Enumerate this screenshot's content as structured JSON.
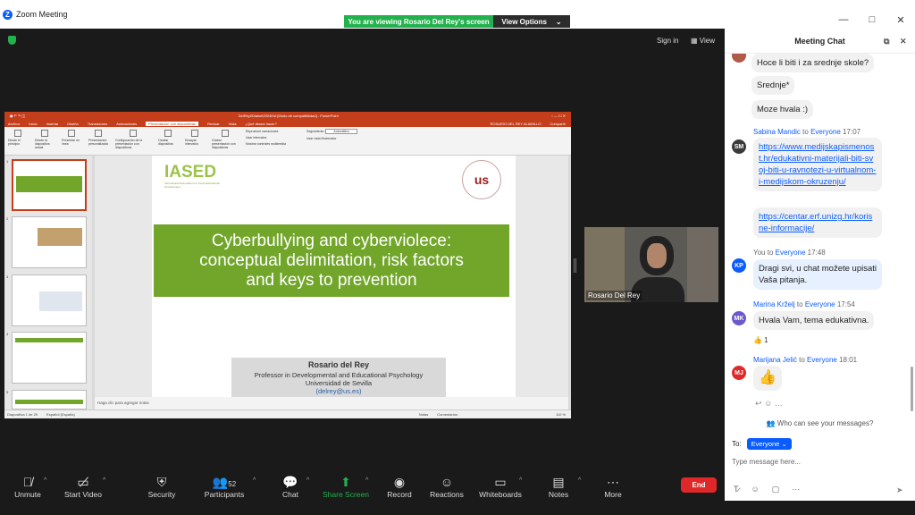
{
  "window": {
    "title": "Zoom Meeting",
    "min": "—",
    "max": "□",
    "close": "✕"
  },
  "banner": {
    "viewing": "You are viewing Rosario Del Rey's screen",
    "view_options": "View Options",
    "caret": "⌄"
  },
  "top": {
    "sign_in": "Sign in",
    "view": "View"
  },
  "ppt": {
    "doc_title": "DelRey2Dialnet2024Esf [Modo de compatibilidad] - PowerPoint",
    "user": "ROSARIO DEL REY ALAMILLO",
    "share": "Compartir",
    "tabs": [
      "Archivo",
      "Inicio",
      "Insertar",
      "Diseño",
      "Transiciones",
      "Animaciones",
      "Presentación con diapositivas",
      "Revisar",
      "Vista",
      "¿Qué desea hacer?"
    ],
    "active_tab": "Presentación con diapositivas",
    "ribbon": [
      "Desde el principio",
      "Desde la diapositiva actual",
      "Presentar en línea",
      "Presentación personalizada",
      "Configuración de la presentación con diapositivas",
      "Ocultar diapositiva",
      "Ensayar intervalos",
      "Grabar presentación con diapositivas"
    ],
    "checks": [
      "Reproducir narraciones",
      "Usar intervalos",
      "Mostrar controles multimedia"
    ],
    "monitor_label": "Seguimiento:",
    "monitor_value": "Automático",
    "presenter": "Usar vista Moderador",
    "thumb_nums": [
      "1",
      "2",
      "3",
      "4",
      "5"
    ],
    "slide": {
      "logo": "IASED",
      "logo_sub": "International Association for Socio-Educational Development",
      "seal": "us",
      "title": "Cyberbullying and cyberviolece: conceptual delimitation, risk factors and keys to prevention",
      "author": "Rosario del Rey",
      "role": "Professor in Developmental and Educational Psychology",
      "univ": "Universidad de Sevilla",
      "email": "delrey@us.es"
    },
    "notes": "Haga clic para agregar notas",
    "status_slide": "Diapositiva 1 de 25",
    "status_lang": "Español (España)",
    "status_notes": "Notas",
    "status_comments": "Comentarios",
    "zoom": "110 %"
  },
  "video": {
    "name": "Rosario Del Rey"
  },
  "chat": {
    "title": "Meeting Chat",
    "popout": "⧉",
    "close": "✕",
    "m1": "Hoce li biti i za srednje skole?",
    "m2": "Srednje*",
    "m3": "Moze hvala :)",
    "s1": {
      "name": "Sabina Mandic",
      "to": "to",
      "target": "Everyone",
      "time": "17:07",
      "avatar": "SM",
      "link1": "https://www.medijskapismenost.hr/edukativni-materijali-biti-svoj-biti-u-ravnotezi-u-virtualnom-i-medijskom-okruzenju/",
      "link2": "https://centar.erf.unizg.hr/korisne-informacije/"
    },
    "s2": {
      "name": "You",
      "to": "to",
      "target": "Everyone",
      "time": "17:48",
      "avatar": "KP",
      "text": "Dragi svi, u chat možete upisati Vaša pitanja."
    },
    "s3": {
      "name": "Marina Krželj",
      "to": "to",
      "target": "Everyone",
      "time": "17:54",
      "avatar": "MK",
      "text": "Hvala Vam, tema edukativna.",
      "reaction": "👍 1"
    },
    "s4": {
      "name": "Marijana Jelić",
      "to": "to",
      "target": "Everyone",
      "time": "18:01",
      "avatar": "MJ",
      "text": "👍"
    },
    "who_can_see": "Who can see your messages?",
    "to_label": "To:",
    "to_value": "Everyone",
    "placeholder": "Type message here..."
  },
  "toolbar": {
    "unmute": "Unmute",
    "start_video": "Start Video",
    "security": "Security",
    "participants": "Participants",
    "participant_count": "52",
    "chat": "Chat",
    "share": "Share Screen",
    "record": "Record",
    "reactions": "Reactions",
    "whiteboards": "Whiteboards",
    "notes": "Notes",
    "more": "More",
    "end": "End"
  },
  "colors": {
    "zoom_blue": "#0b5cff",
    "share_green": "#23b14d",
    "end_red": "#e02828",
    "ppt_orange": "#c43e1c",
    "slide_green": "#72a62a"
  }
}
